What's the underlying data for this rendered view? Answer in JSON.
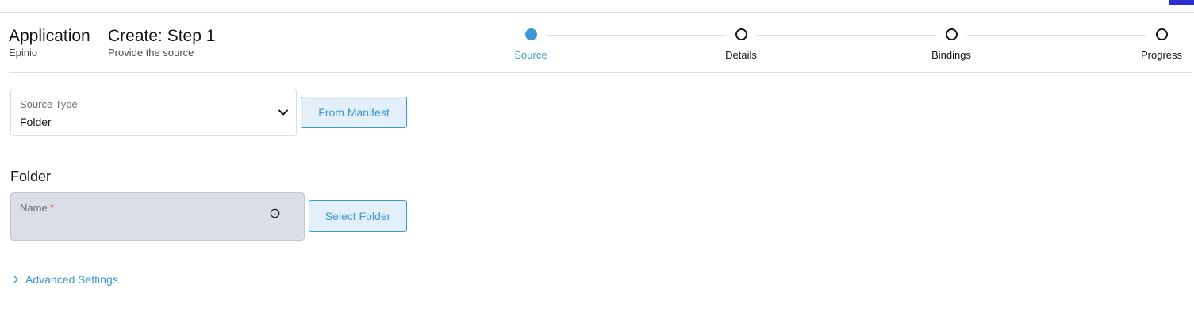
{
  "header": {
    "app_title": "Application",
    "app_subtitle": "Epinio",
    "page_title": "Create: Step 1",
    "page_subtitle": "Provide the source"
  },
  "steps": [
    {
      "label": "Source",
      "active": true
    },
    {
      "label": "Details",
      "active": false
    },
    {
      "label": "Bindings",
      "active": false
    },
    {
      "label": "Progress",
      "active": false
    }
  ],
  "source": {
    "label": "Source Type",
    "value": "Folder",
    "from_manifest_label": "From Manifest"
  },
  "folder": {
    "section_title": "Folder",
    "name_label": "Name",
    "required_mark": "*",
    "select_folder_label": "Select Folder"
  },
  "advanced": {
    "label": "Advanced Settings"
  },
  "colors": {
    "accent": "#3d98d3",
    "border": "#dcdee7",
    "required": "#f64747",
    "corner_badge": "#2b2fd1"
  },
  "icons": {
    "source_chevron": "chevron-down-icon",
    "name_info": "info-icon",
    "advanced_caret": "chevron-right-icon"
  }
}
